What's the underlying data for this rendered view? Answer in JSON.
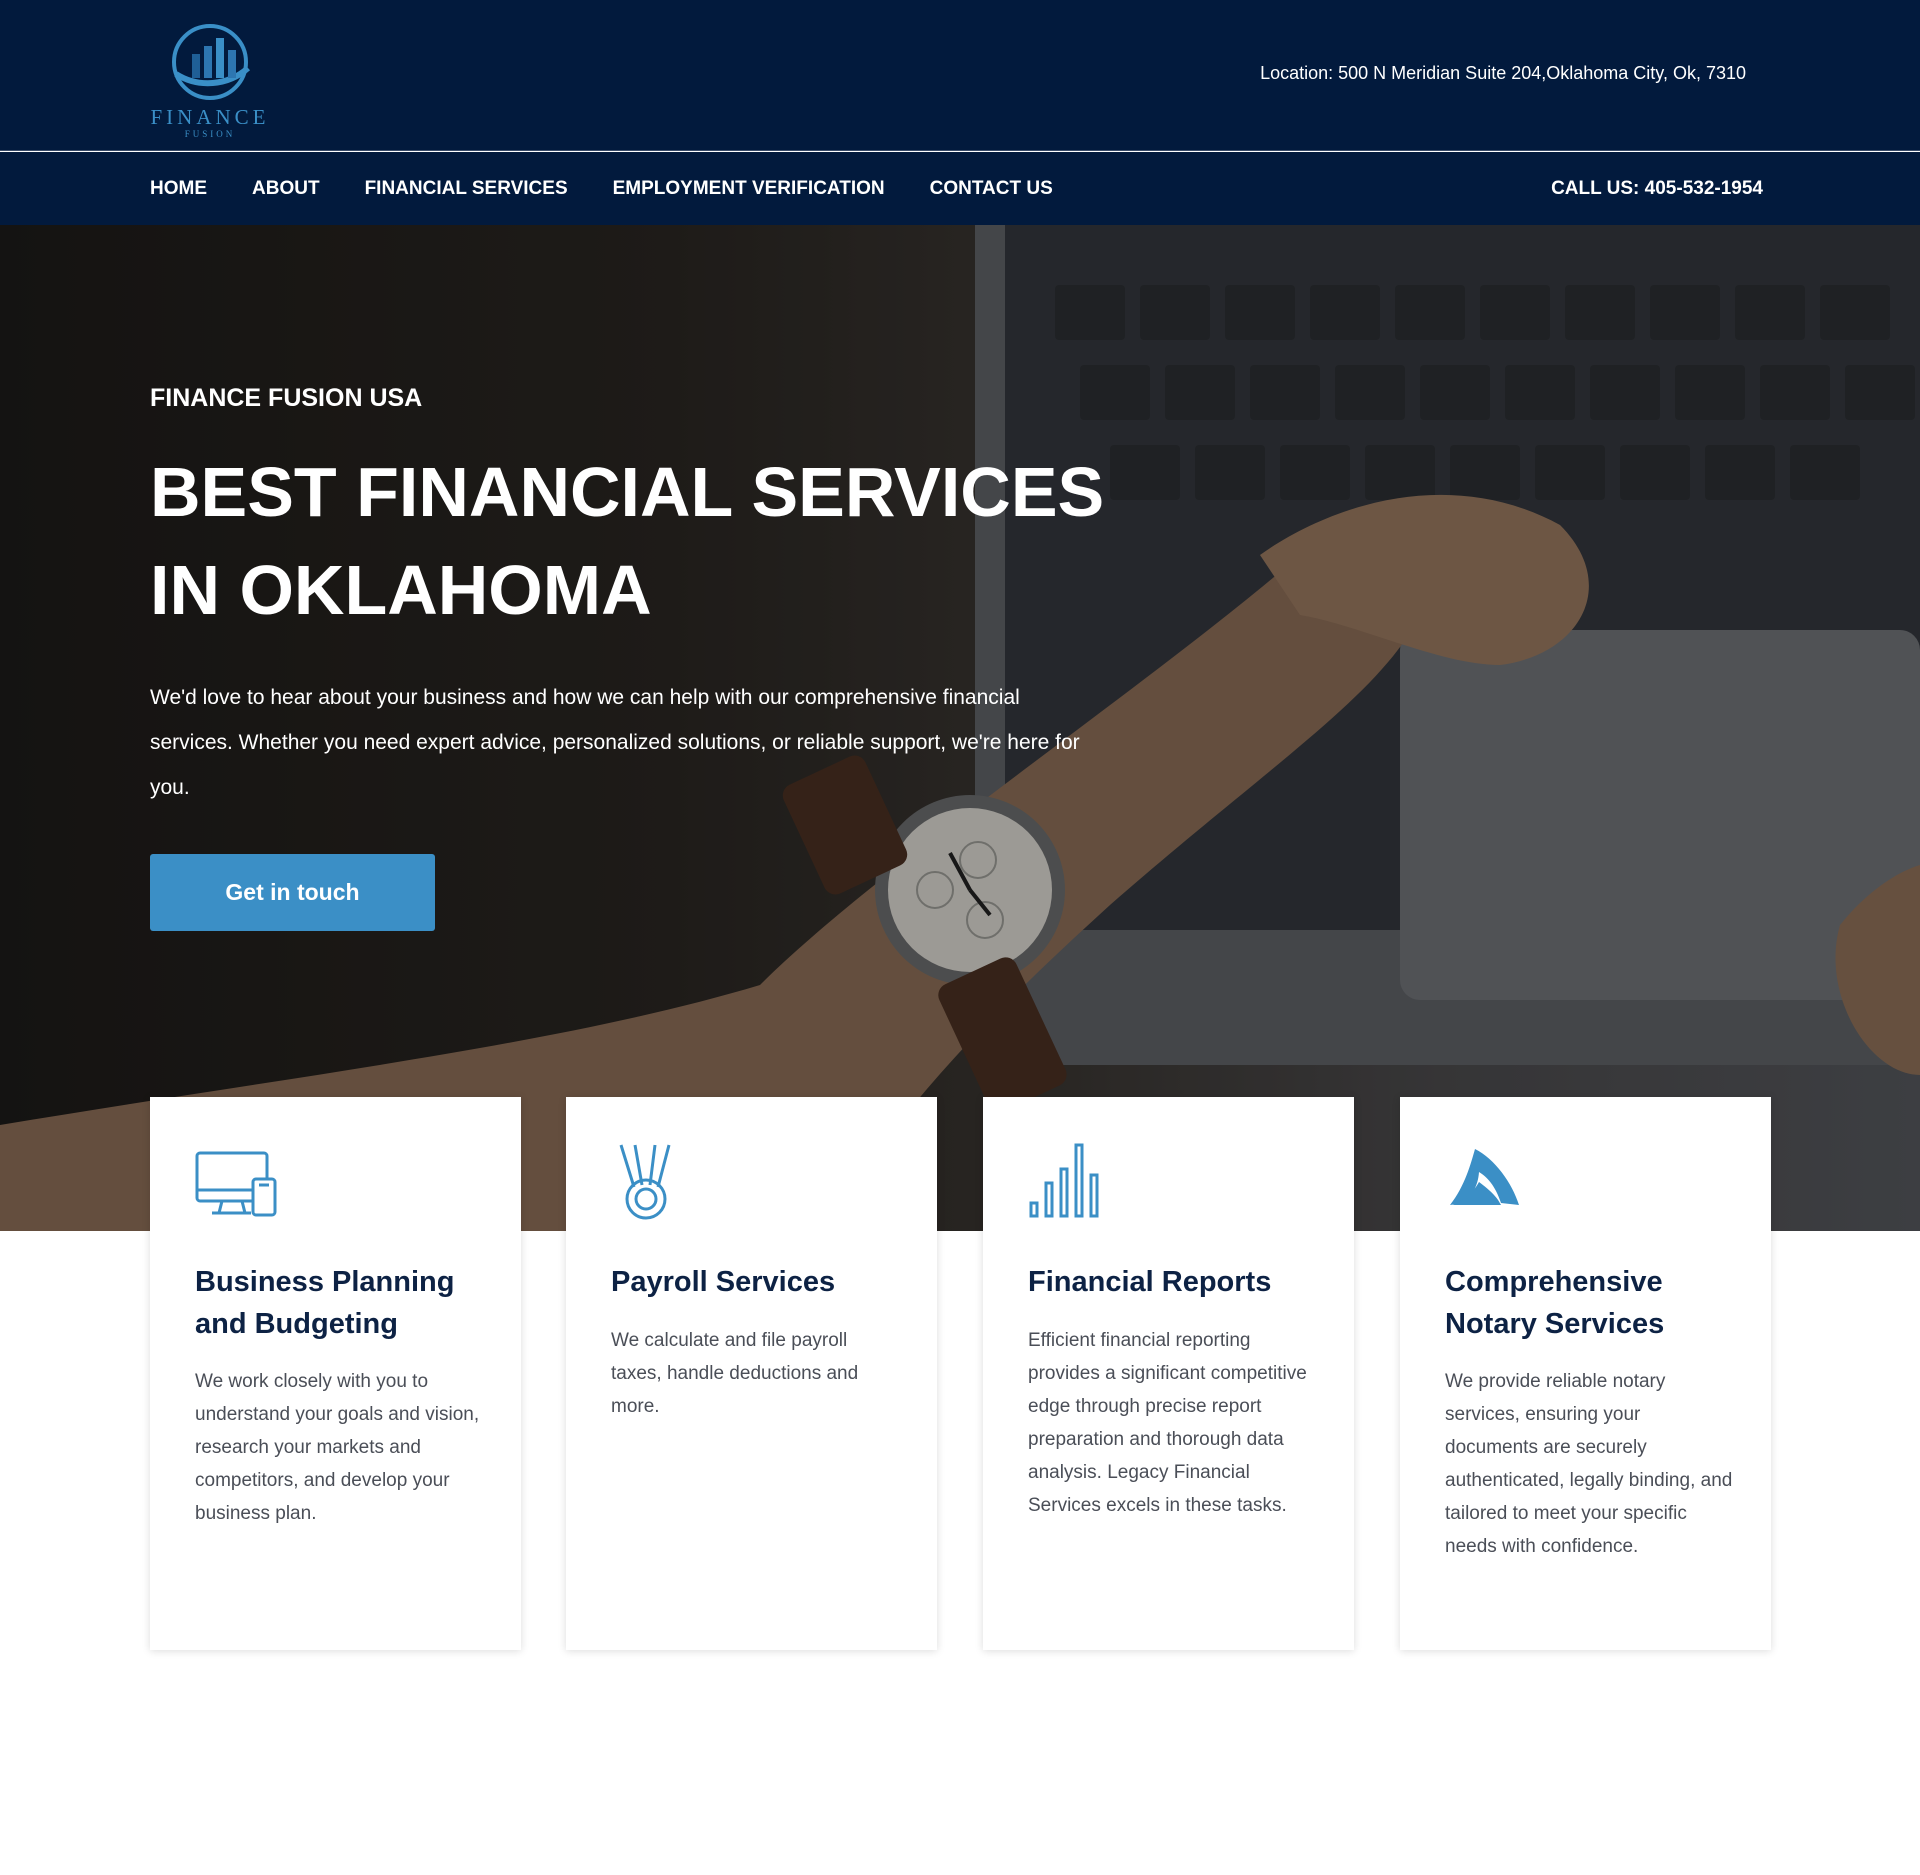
{
  "header": {
    "logo_text": "FINANCE",
    "logo_subtext": "FUSION",
    "location": "Location: 500 N Meridian Suite 204,Oklahoma City, Ok, 7310"
  },
  "nav": {
    "items": [
      "HOME",
      "ABOUT",
      "FINANCIAL SERVICES",
      "EMPLOYMENT VERIFICATION",
      "CONTACT US"
    ],
    "call": "CALL US: 405-532-1954"
  },
  "hero": {
    "kicker": "FINANCE FUSION USA",
    "title": "BEST FINANCIAL SERVICES IN OKLAHOMA",
    "text": "We'd love to hear about your business and how we can help with our comprehensive financial services. Whether you need expert advice, personalized solutions, or reliable support, we're here for you.",
    "button": "Get in touch"
  },
  "cards": [
    {
      "icon": "devices-icon",
      "title": "Business Planning and Budgeting",
      "text": "We work closely with you to understand your goals and vision, research your markets and competitors, and develop your business plan."
    },
    {
      "icon": "medal-icon",
      "title": "Payroll Services",
      "text": "We calculate and file payroll taxes, handle deductions and more."
    },
    {
      "icon": "bar-chart-icon",
      "title": "Financial Reports",
      "text": "Efficient financial reporting provides a significant competitive edge through precise report preparation and thorough data analysis. Legacy Financial Services excels in these tasks."
    },
    {
      "icon": "fin-icon",
      "title": "Comprehensive Notary Services",
      "text": "We provide reliable notary services, ensuring your documents are securely authenticated, legally binding, and tailored to meet your specific needs with confidence."
    }
  ],
  "colors": {
    "navy": "#021a3d",
    "accent": "#3b8fc6",
    "title_text": "#0d2244",
    "body_text": "#4a4e57"
  }
}
